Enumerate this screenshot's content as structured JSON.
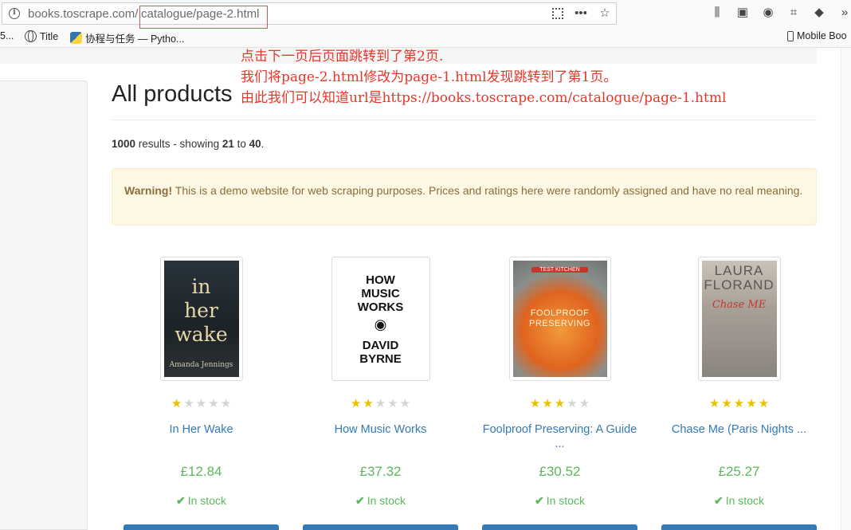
{
  "browser": {
    "url_domain": "books.toscrape.com/",
    "url_path": "catalogue/page-2.html",
    "bookmarks": [
      {
        "label": "5..."
      },
      {
        "label": "Title",
        "icon": "globe-icon"
      },
      {
        "label": "协程与任务 — Pytho...",
        "icon": "python-icon"
      },
      {
        "label": "Mobile Boo",
        "icon": "phone-icon"
      }
    ]
  },
  "annotation": {
    "line1": "点击下一页后页面跳转到了第2页.",
    "line2": "我们将page-2.html修改为page-1.html发现跳转到了第1页。",
    "line3": "由此我们可以知道url是https://books.toscrape.com/catalogue/page-1.html"
  },
  "page": {
    "title": "All products",
    "results": {
      "total": "1000",
      "mid": " results - showing ",
      "from": "21",
      "to_word": " to ",
      "to": "40",
      "end": "."
    },
    "warning": {
      "strong": "Warning!",
      "text": " This is a demo website for web scraping purposes. Prices and ratings here were randomly assigned and have no real meaning."
    }
  },
  "products": [
    {
      "title": "In Her Wake",
      "price": "£12.84",
      "stock": "In stock",
      "rating": 1,
      "cover": {
        "lines": [
          "in",
          "her",
          "wake"
        ],
        "author": "Amanda Jennings"
      }
    },
    {
      "title": "How Music Works",
      "price": "£37.32",
      "stock": "In stock",
      "rating": 2,
      "cover": {
        "lines": [
          "HOW",
          "MUSIC",
          "WORKS"
        ],
        "author": "DAVID BYRNE"
      }
    },
    {
      "title": "Foolproof Preserving: A Guide ...",
      "price": "£30.52",
      "stock": "In stock",
      "rating": 3,
      "cover": {
        "lines": [
          "FOOLPROOF",
          "PRESERVING"
        ],
        "kicker": "TEST KITCHEN"
      }
    },
    {
      "title": "Chase Me (Paris Nights ...",
      "price": "£25.27",
      "stock": "In stock",
      "rating": 5,
      "cover": {
        "lines": [
          "LAURA",
          "FLORAND"
        ],
        "script": "Chase ME"
      }
    }
  ],
  "colors": {
    "link": "#337ab7",
    "price": "#5cb85c",
    "star": "#e6c200",
    "annotation": "#e8362a",
    "warning_bg": "#fcf8e3"
  }
}
